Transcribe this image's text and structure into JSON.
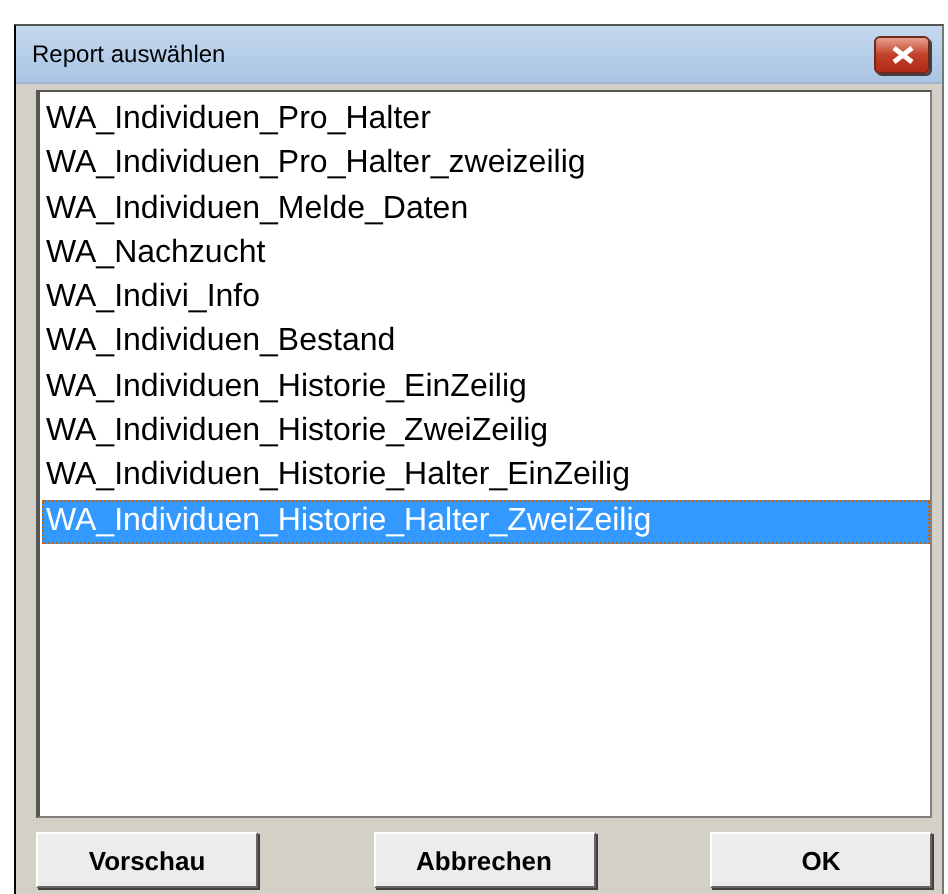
{
  "window": {
    "title": "Report auswählen"
  },
  "reports": [
    {
      "label": "WA_Individuen_Pro_Halter",
      "selected": false
    },
    {
      "label": "WA_Individuen_Pro_Halter_zweizeilig",
      "selected": false
    },
    {
      "label": "WA_Individuen_Melde_Daten",
      "selected": false
    },
    {
      "label": "WA_Nachzucht",
      "selected": false
    },
    {
      "label": "WA_Indivi_Info",
      "selected": false
    },
    {
      "label": "WA_Individuen_Bestand",
      "selected": false
    },
    {
      "label": "WA_Individuen_Historie_EinZeilig",
      "selected": false
    },
    {
      "label": "WA_Individuen_Historie_ZweiZeilig",
      "selected": false
    },
    {
      "label": "WA_Individuen_Historie_Halter_EinZeilig",
      "selected": false
    },
    {
      "label": "WA_Individuen_Historie_Halter_ZweiZeilig",
      "selected": true
    }
  ],
  "buttons": [
    "Vorschau",
    "Abbrechen",
    "OK"
  ]
}
